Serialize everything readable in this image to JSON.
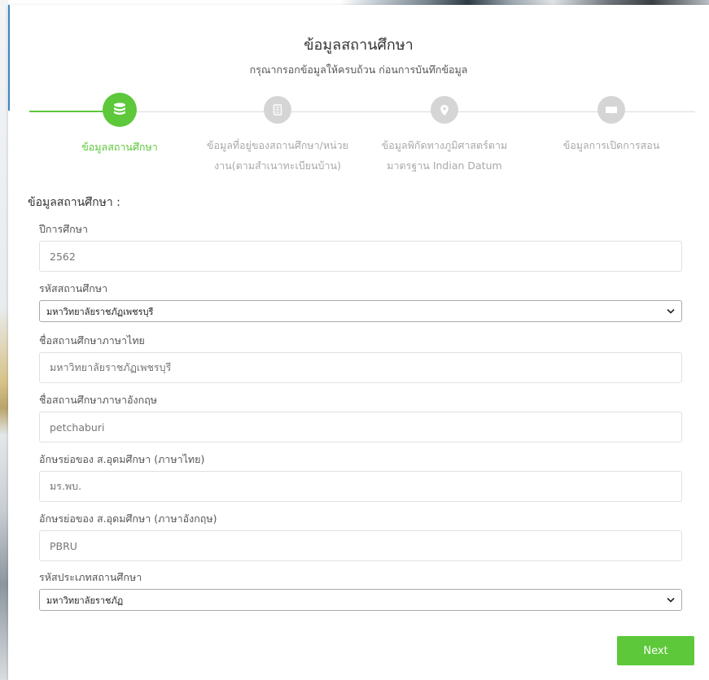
{
  "header": {
    "title": "ข้อมูลสถานศึกษา",
    "subtitle": "กรุณากรอกข้อมูลให้ครบถ้วน ก่อนการบันทึกข้อมูล"
  },
  "stepper": {
    "steps": [
      {
        "label_line1": "ข้อมูลสถานศึกษา",
        "label_line2": "",
        "icon": "database-icon",
        "active": true
      },
      {
        "label_line1": "ข้อมูลที่อยู่ของสถานศึกษา/หน่วย",
        "label_line2": "งาน(ตามสำเนาทะเบียนบ้าน)",
        "icon": "building-icon",
        "active": false
      },
      {
        "label_line1": "ข้อมูลพิกัดทางภูมิศาสตร์ตาม",
        "label_line2": "มาตรฐาน Indian Datum",
        "icon": "map-pin-icon",
        "active": false
      },
      {
        "label_line1": "ข้อมูลการเปิดการสอน",
        "label_line2": "",
        "icon": "book-icon",
        "active": false
      }
    ]
  },
  "form": {
    "section_title": "ข้อมูลสถานศึกษา :",
    "academic_year": {
      "label": "ปีการศึกษา",
      "value": "2562"
    },
    "institution_code": {
      "label": "รหัสสถานศึกษา",
      "value": "มหาวิทยาลัยราชภัฏเพชรบุรี"
    },
    "name_th": {
      "label": "ชื่อสถานศึกษาภาษาไทย",
      "value": "มหาวิทยาลัยราชภัฏเพชรบุรี"
    },
    "name_en": {
      "label": "ชื่อสถานศึกษาภาษาอังกฤษ",
      "value": "petchaburi"
    },
    "abbr_th": {
      "label": "อักษรย่อของ ส.อุดมศึกษา (ภาษาไทย)",
      "value": "มร.พบ."
    },
    "abbr_en": {
      "label": "อักษรย่อของ ส.อุดมศึกษา (ภาษาอังกฤษ)",
      "value": "PBRU"
    },
    "institution_type": {
      "label": "รหัสประเภทสถานศึกษา",
      "value": "มหาวิทยาลัยราชภัฏ"
    },
    "next_label": "Next"
  },
  "colors": {
    "accent": "#5cc83a",
    "inactive_step": "#d5d5d5"
  }
}
